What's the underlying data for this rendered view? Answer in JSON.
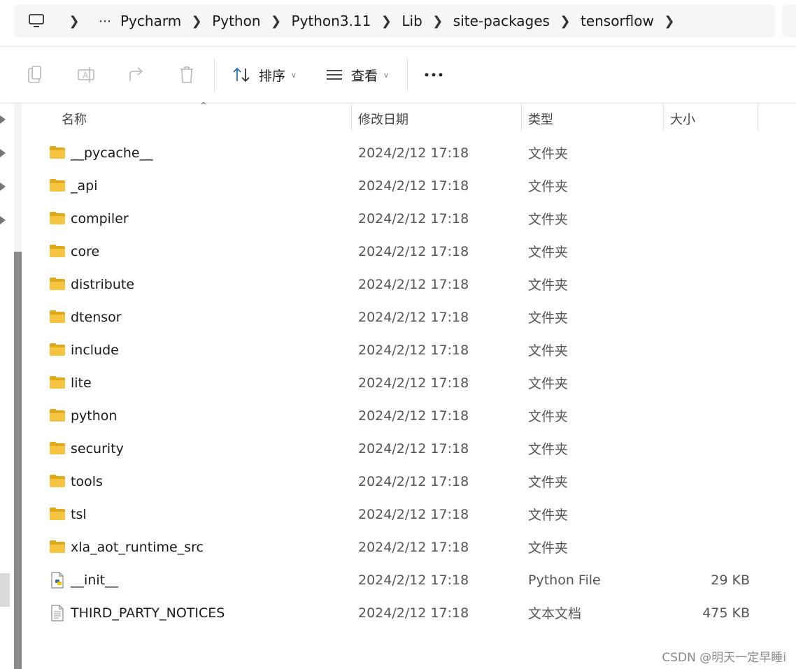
{
  "breadcrumb": {
    "items": [
      "Pycharm",
      "Python",
      "Python3.11",
      "Lib",
      "site-packages",
      "tensorflow"
    ]
  },
  "toolbar": {
    "sort_label": "排序",
    "view_label": "查看"
  },
  "columns": {
    "name": "名称",
    "date": "修改日期",
    "type": "类型",
    "size": "大小"
  },
  "files": [
    {
      "name": "__pycache__",
      "date": "2024/2/12 17:18",
      "type": "文件夹",
      "size": "",
      "icon": "folder-icon"
    },
    {
      "name": "_api",
      "date": "2024/2/12 17:18",
      "type": "文件夹",
      "size": "",
      "icon": "folder-icon"
    },
    {
      "name": "compiler",
      "date": "2024/2/12 17:18",
      "type": "文件夹",
      "size": "",
      "icon": "folder-icon"
    },
    {
      "name": "core",
      "date": "2024/2/12 17:18",
      "type": "文件夹",
      "size": "",
      "icon": "folder-icon"
    },
    {
      "name": "distribute",
      "date": "2024/2/12 17:18",
      "type": "文件夹",
      "size": "",
      "icon": "folder-icon"
    },
    {
      "name": "dtensor",
      "date": "2024/2/12 17:18",
      "type": "文件夹",
      "size": "",
      "icon": "folder-icon"
    },
    {
      "name": "include",
      "date": "2024/2/12 17:18",
      "type": "文件夹",
      "size": "",
      "icon": "folder-icon"
    },
    {
      "name": "lite",
      "date": "2024/2/12 17:18",
      "type": "文件夹",
      "size": "",
      "icon": "folder-icon"
    },
    {
      "name": "python",
      "date": "2024/2/12 17:18",
      "type": "文件夹",
      "size": "",
      "icon": "folder-icon"
    },
    {
      "name": "security",
      "date": "2024/2/12 17:18",
      "type": "文件夹",
      "size": "",
      "icon": "folder-icon"
    },
    {
      "name": "tools",
      "date": "2024/2/12 17:18",
      "type": "文件夹",
      "size": "",
      "icon": "folder-icon"
    },
    {
      "name": "tsl",
      "date": "2024/2/12 17:18",
      "type": "文件夹",
      "size": "",
      "icon": "folder-icon"
    },
    {
      "name": "xla_aot_runtime_src",
      "date": "2024/2/12 17:18",
      "type": "文件夹",
      "size": "",
      "icon": "folder-icon"
    },
    {
      "name": "__init__",
      "date": "2024/2/12 17:18",
      "type": "Python File",
      "size": "29 KB",
      "icon": "python-file-icon"
    },
    {
      "name": "THIRD_PARTY_NOTICES",
      "date": "2024/2/12 17:18",
      "type": "文本文档",
      "size": "475 KB",
      "icon": "text-file-icon"
    }
  ],
  "watermark": "CSDN @明天一定早睡i",
  "colors": {
    "folder": "#f5c542",
    "folder_dark": "#e0a91a",
    "accent": "#2b6cb0"
  }
}
